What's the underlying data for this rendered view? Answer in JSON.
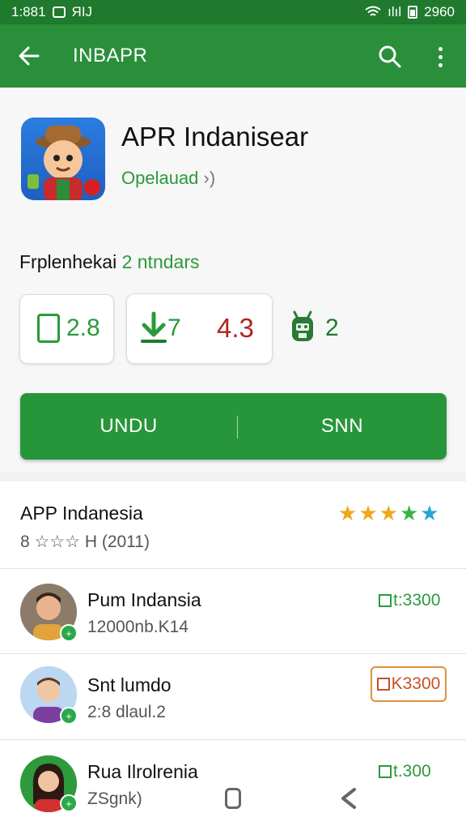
{
  "status_bar": {
    "time": "1:881",
    "label": "ЯIJ",
    "icons": [
      "gallery-icon",
      "wifi-icon",
      "signal-icon",
      "battery-icon"
    ],
    "signal_text": "ılıl",
    "battery_text": "2960"
  },
  "app_bar": {
    "title": "INBAPR",
    "icons": [
      "arrow-left-icon",
      "search-icon",
      "more-vert-icon"
    ]
  },
  "app": {
    "name": "APR Indanisear",
    "status": "Opelauad",
    "status_suffix": "›)",
    "rating_line_prefix": "Frplenhekai",
    "rating_line_accent": "2 ntndars"
  },
  "stats": [
    {
      "icon": "phone-icon",
      "value": "2.8"
    },
    {
      "icon": "download-icon",
      "value": "7",
      "extra": "4.3"
    },
    {
      "icon": "android-icon",
      "value": "2"
    }
  ],
  "actions": {
    "primary": "UNDU",
    "secondary": "SNN"
  },
  "list_header": {
    "title": "APP Indanesia",
    "subtitle": "8 ☆☆☆ H (2011)",
    "stars": [
      "#f2a71b",
      "#f2a71b",
      "#f2a71b",
      "#37b34a",
      "#2aa3d8"
    ]
  },
  "items": [
    {
      "name": "Pum Indansia",
      "sub": "12000nb.K14",
      "price": "t:3300",
      "badge": "+"
    },
    {
      "name": "Snt lumdo",
      "sub": "2:8 dlaul.2",
      "price": "K3300",
      "badge": "+"
    },
    {
      "name": "Rua Ilrolrenia",
      "sub": "ZSgnk)",
      "price": "t.300",
      "badge": "+"
    }
  ],
  "nav": {
    "icons": [
      "home-icon",
      "back-icon"
    ]
  }
}
